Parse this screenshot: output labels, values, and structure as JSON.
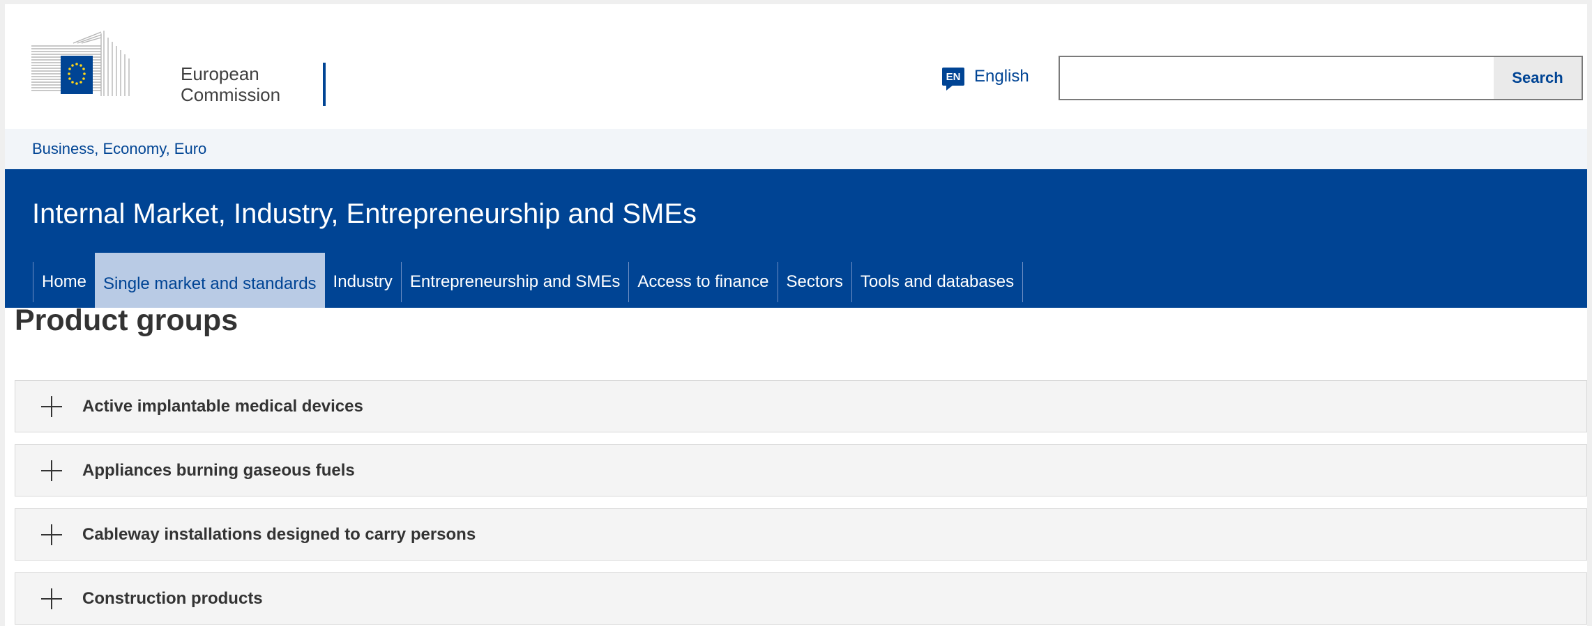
{
  "header": {
    "logo_text_line1": "European",
    "logo_text_line2": "Commission",
    "language": {
      "code": "EN",
      "label": "English"
    },
    "search": {
      "placeholder": "",
      "value": "",
      "button_label": "Search"
    }
  },
  "breadcrumb": {
    "label": "Business, Economy, Euro"
  },
  "site": {
    "title": "Internal Market, Industry, Entrepreneurship and SMEs",
    "nav": [
      {
        "label": "Home"
      },
      {
        "label": "Single market and standards",
        "active": true
      },
      {
        "label": "Industry"
      },
      {
        "label": "Entrepreneurship and SMEs"
      },
      {
        "label": "Access to finance"
      },
      {
        "label": "Sectors"
      },
      {
        "label": "Tools and databases"
      }
    ]
  },
  "page": {
    "title": "Product groups",
    "accordion": [
      {
        "label": "Active implantable medical devices"
      },
      {
        "label": "Appliances burning gaseous fuels"
      },
      {
        "label": "Cableway installations designed to carry persons"
      },
      {
        "label": "Construction products"
      }
    ]
  },
  "colors": {
    "brand_blue": "#004494",
    "active_nav": "#b9cbe5",
    "eu_gold": "#ffd617"
  }
}
